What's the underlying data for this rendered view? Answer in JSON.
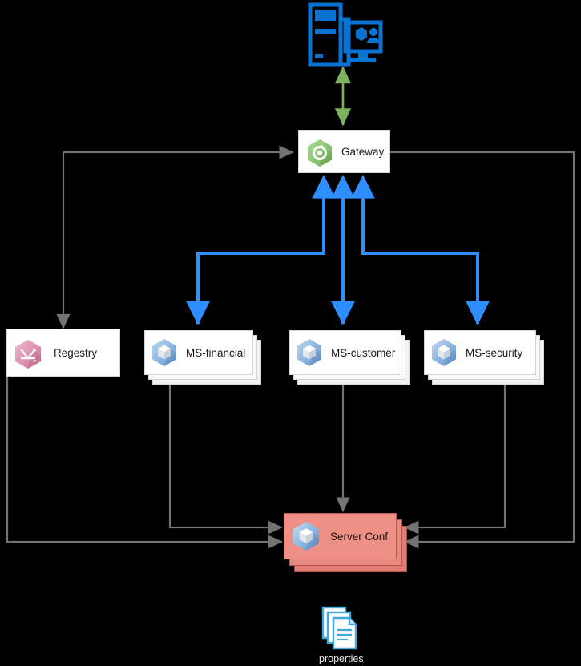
{
  "diagram": {
    "title": "Microservices architecture diagram",
    "colors": {
      "blue_arrow": "#2E8DFF",
      "green_arrow": "#7CB35C",
      "gray_arrow": "#737373",
      "gateway_hex": "#86C66B",
      "registry_hex": "#DD8FB0",
      "service_hex": "#6FA8DC",
      "server_conf_fill": "#EE9086",
      "properties_icon": "#3FA9E0",
      "workstation_icon": "#0A72D0"
    }
  },
  "nodes": {
    "workstation": {
      "label": "",
      "icon": "workstation-icon"
    },
    "gateway": {
      "label": "Gateway",
      "icon": "gateway-hex-icon"
    },
    "registry": {
      "label": "Regestry",
      "icon": "registry-hex-icon"
    },
    "ms_financial": {
      "label": "MS-financial",
      "icon": "service-cube-hex-icon"
    },
    "ms_customer": {
      "label": "MS-customer",
      "icon": "service-cube-hex-icon"
    },
    "ms_security": {
      "label": "MS-security",
      "icon": "service-cube-hex-icon"
    },
    "server_conf": {
      "label": "Server Conf",
      "icon": "service-cube-hex-icon"
    },
    "properties": {
      "label": "properties",
      "icon": "documents-stack-icon"
    }
  },
  "connections": [
    {
      "name": "workstation-gateway",
      "from": "workstation",
      "to": "gateway",
      "color": "#7CB35C",
      "arrows": "both"
    },
    {
      "name": "registry-gateway",
      "from": "registry",
      "to": "gateway",
      "color": "#737373",
      "arrows": "both"
    },
    {
      "name": "gateway-ms-financial",
      "from": "gateway",
      "to": "ms_financial",
      "color": "#2E8DFF",
      "arrows": "both"
    },
    {
      "name": "gateway-ms-customer",
      "from": "gateway",
      "to": "ms_customer",
      "color": "#2E8DFF",
      "arrows": "both"
    },
    {
      "name": "gateway-ms-security",
      "from": "gateway",
      "to": "ms_security",
      "color": "#2E8DFF",
      "arrows": "both"
    },
    {
      "name": "registry-server-conf",
      "from": "registry",
      "to": "server_conf",
      "color": "#737373",
      "arrows": "end"
    },
    {
      "name": "ms-financial-server-conf",
      "from": "ms_financial",
      "to": "server_conf",
      "color": "#737373",
      "arrows": "end"
    },
    {
      "name": "ms-customer-server-conf",
      "from": "ms_customer",
      "to": "server_conf",
      "color": "#737373",
      "arrows": "end"
    },
    {
      "name": "ms-security-server-conf",
      "from": "ms_security",
      "to": "server_conf",
      "color": "#737373",
      "arrows": "end"
    },
    {
      "name": "gateway-server-conf",
      "from": "gateway",
      "to": "server_conf",
      "color": "#737373",
      "arrows": "end"
    }
  ]
}
